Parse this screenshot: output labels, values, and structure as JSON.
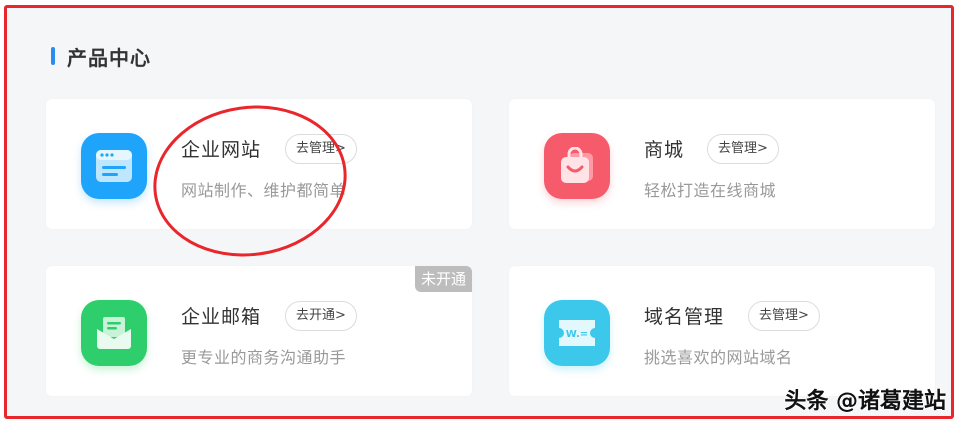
{
  "section": {
    "title": "产品中心",
    "accent_color": "#2b8cf0"
  },
  "cards": [
    {
      "name": "企业网站",
      "action": "去管理>",
      "description": "网站制作、维护都简单",
      "icon": "website-icon",
      "color": "#1fa4fb"
    },
    {
      "name": "商城",
      "action": "去管理>",
      "description": "轻松打造在线商城",
      "icon": "shopping-bag-icon",
      "color": "#f65b6b"
    },
    {
      "name": "企业邮箱",
      "action": "去开通>",
      "description": "更专业的商务沟通助手",
      "icon": "mail-icon",
      "color": "#2fce6c",
      "status": "未开通"
    },
    {
      "name": "域名管理",
      "action": "去管理>",
      "description": "挑选喜欢的网站域名",
      "icon": "domain-ticket-icon",
      "color": "#3bc8ea"
    }
  ],
  "domain_icon_text": "W.=",
  "annotation": {
    "color": "#e8262b"
  },
  "watermark": "头条 @诸葛建站"
}
